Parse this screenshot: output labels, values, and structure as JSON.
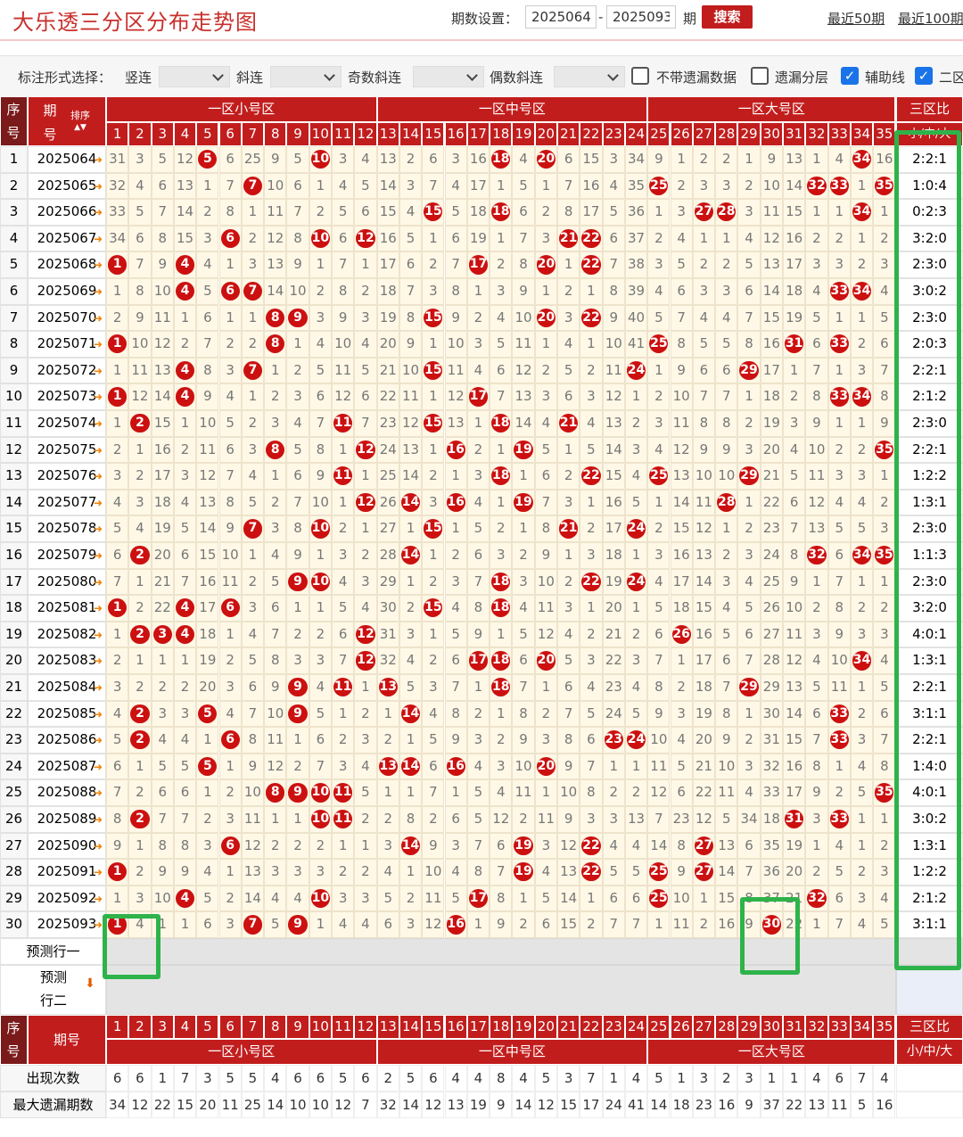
{
  "title": "大乐透三分区分布走势图",
  "period_setting": {
    "label": "期数设置：",
    "from": "2025064",
    "dash": "-",
    "to": "2025093",
    "unit": "期",
    "search": "搜索"
  },
  "links": [
    "最近50期",
    "最近100期"
  ],
  "filters": {
    "label": "标注形式选择：",
    "items": [
      "竖连",
      "斜连",
      "奇数斜连",
      "偶数斜连"
    ],
    "checks": [
      {
        "label": "不带遗漏数据",
        "checked": false
      },
      {
        "label": "遗漏分层",
        "checked": false
      },
      {
        "label": "辅助线",
        "checked": true
      },
      {
        "label": "二区",
        "checked": true
      }
    ]
  },
  "header": {
    "seq": "序号",
    "period": "期号",
    "sort": "排序",
    "zones": [
      "一区小号区",
      "一区中号区",
      "一区大号区"
    ],
    "ratio": "三区比",
    "ratio_sub": "小/中/大"
  },
  "numbers": [
    "1",
    "2",
    "3",
    "4",
    "5",
    "6",
    "7",
    "8",
    "9",
    "10",
    "11",
    "12",
    "13",
    "14",
    "15",
    "16",
    "17",
    "18",
    "19",
    "20",
    "21",
    "22",
    "23",
    "24",
    "25",
    "26",
    "27",
    "28",
    "29",
    "30",
    "31",
    "32",
    "33",
    "34",
    "35"
  ],
  "rows": [
    {
      "seq": "1",
      "period": "2025064",
      "ratio": "2:2:1",
      "cells": [
        31,
        3,
        5,
        12,
        "*",
        6,
        25,
        9,
        5,
        "*",
        3,
        4,
        13,
        2,
        6,
        3,
        16,
        "*",
        4,
        "*",
        6,
        15,
        3,
        34,
        9,
        1,
        2,
        2,
        1,
        9,
        13,
        1,
        4,
        "*",
        16
      ]
    },
    {
      "seq": "2",
      "period": "2025065",
      "ratio": "1:0:4",
      "cells": [
        32,
        4,
        6,
        13,
        1,
        7,
        "*",
        10,
        6,
        1,
        4,
        5,
        14,
        3,
        7,
        4,
        17,
        1,
        5,
        1,
        7,
        16,
        4,
        35,
        "*",
        2,
        3,
        3,
        2,
        10,
        14,
        "*",
        "*",
        1,
        "*"
      ]
    },
    {
      "seq": "3",
      "period": "2025066",
      "ratio": "0:2:3",
      "cells": [
        33,
        5,
        7,
        14,
        2,
        8,
        1,
        11,
        7,
        2,
        5,
        6,
        15,
        4,
        "*",
        5,
        18,
        "*",
        6,
        2,
        8,
        17,
        5,
        36,
        1,
        3,
        "*",
        "*",
        3,
        11,
        15,
        1,
        1,
        "*",
        1
      ]
    },
    {
      "seq": "4",
      "period": "2025067",
      "ratio": "3:2:0",
      "cells": [
        34,
        6,
        8,
        15,
        3,
        "*",
        2,
        12,
        8,
        "*",
        6,
        "*",
        16,
        5,
        1,
        6,
        19,
        1,
        7,
        3,
        "*",
        "*",
        6,
        37,
        2,
        4,
        1,
        1,
        4,
        12,
        16,
        2,
        2,
        1,
        2
      ]
    },
    {
      "seq": "5",
      "period": "2025068",
      "ratio": "2:3:0",
      "cells": [
        "*",
        7,
        9,
        "*",
        4,
        1,
        3,
        13,
        9,
        1,
        7,
        1,
        17,
        6,
        2,
        7,
        "*",
        2,
        8,
        "*",
        1,
        "*",
        7,
        38,
        3,
        5,
        2,
        2,
        5,
        13,
        17,
        3,
        3,
        2,
        3
      ]
    },
    {
      "seq": "6",
      "period": "2025069",
      "ratio": "3:0:2",
      "cells": [
        1,
        8,
        10,
        "*",
        5,
        "*",
        "*",
        14,
        10,
        2,
        8,
        2,
        18,
        7,
        3,
        8,
        1,
        3,
        9,
        1,
        2,
        1,
        8,
        39,
        4,
        6,
        3,
        3,
        6,
        14,
        18,
        4,
        "*",
        "*",
        4
      ]
    },
    {
      "seq": "7",
      "period": "2025070",
      "ratio": "2:3:0",
      "cells": [
        2,
        9,
        11,
        1,
        6,
        1,
        1,
        "*",
        "*",
        3,
        9,
        3,
        19,
        8,
        "*",
        9,
        2,
        4,
        10,
        "*",
        3,
        "*",
        9,
        40,
        5,
        7,
        4,
        4,
        7,
        15,
        19,
        5,
        1,
        1,
        5
      ]
    },
    {
      "seq": "8",
      "period": "2025071",
      "ratio": "2:0:3",
      "cells": [
        "*",
        10,
        12,
        2,
        7,
        2,
        2,
        "*",
        1,
        4,
        10,
        4,
        20,
        9,
        1,
        10,
        3,
        5,
        11,
        1,
        4,
        1,
        10,
        41,
        "*",
        8,
        5,
        5,
        8,
        16,
        "*",
        6,
        "*",
        2,
        6
      ]
    },
    {
      "seq": "9",
      "period": "2025072",
      "ratio": "2:2:1",
      "cells": [
        1,
        11,
        13,
        "*",
        8,
        3,
        "*",
        1,
        2,
        5,
        11,
        5,
        21,
        10,
        "*",
        11,
        4,
        6,
        12,
        2,
        5,
        2,
        11,
        "*",
        1,
        9,
        6,
        6,
        "*",
        17,
        1,
        7,
        1,
        3,
        7
      ]
    },
    {
      "seq": "10",
      "period": "2025073",
      "ratio": "2:1:2",
      "cells": [
        "*",
        12,
        14,
        "*",
        9,
        4,
        1,
        2,
        3,
        6,
        12,
        6,
        22,
        11,
        1,
        12,
        "*",
        7,
        13,
        3,
        6,
        3,
        12,
        1,
        2,
        10,
        7,
        7,
        1,
        18,
        2,
        8,
        "*",
        "*",
        8
      ]
    },
    {
      "seq": "11",
      "period": "2025074",
      "ratio": "2:3:0",
      "cells": [
        1,
        "*",
        15,
        1,
        10,
        5,
        2,
        3,
        4,
        7,
        "*",
        7,
        23,
        12,
        "*",
        13,
        1,
        "*",
        14,
        4,
        "*",
        4,
        13,
        2,
        3,
        11,
        8,
        8,
        2,
        19,
        3,
        9,
        1,
        1,
        9
      ]
    },
    {
      "seq": "12",
      "period": "2025075",
      "ratio": "2:2:1",
      "cells": [
        2,
        1,
        16,
        2,
        11,
        6,
        3,
        "*",
        5,
        8,
        1,
        "*",
        24,
        13,
        1,
        "*",
        2,
        1,
        "*",
        5,
        1,
        5,
        14,
        3,
        4,
        12,
        9,
        9,
        3,
        20,
        4,
        10,
        2,
        2,
        "*"
      ]
    },
    {
      "seq": "13",
      "period": "2025076",
      "ratio": "1:2:2",
      "cells": [
        3,
        2,
        17,
        3,
        12,
        7,
        4,
        1,
        6,
        9,
        "*",
        1,
        25,
        14,
        2,
        1,
        3,
        "*",
        1,
        6,
        2,
        "*",
        15,
        4,
        "*",
        13,
        10,
        10,
        "*",
        21,
        5,
        11,
        3,
        3,
        1
      ]
    },
    {
      "seq": "14",
      "period": "2025077",
      "ratio": "1:3:1",
      "cells": [
        4,
        3,
        18,
        4,
        13,
        8,
        5,
        2,
        7,
        10,
        1,
        "*",
        26,
        "*",
        3,
        "*",
        4,
        1,
        "*",
        7,
        3,
        1,
        16,
        5,
        1,
        14,
        11,
        "*",
        1,
        22,
        6,
        12,
        4,
        4,
        2
      ]
    },
    {
      "seq": "15",
      "period": "2025078",
      "ratio": "2:3:0",
      "cells": [
        5,
        4,
        19,
        5,
        14,
        9,
        "*",
        3,
        8,
        "*",
        2,
        1,
        27,
        1,
        "*",
        1,
        5,
        2,
        1,
        8,
        "*",
        2,
        17,
        "*",
        2,
        15,
        12,
        1,
        2,
        23,
        7,
        13,
        5,
        5,
        3
      ]
    },
    {
      "seq": "16",
      "period": "2025079",
      "ratio": "1:1:3",
      "cells": [
        6,
        "*",
        20,
        6,
        15,
        10,
        1,
        4,
        9,
        1,
        3,
        2,
        28,
        "*",
        1,
        2,
        6,
        3,
        2,
        9,
        1,
        3,
        18,
        1,
        3,
        16,
        13,
        2,
        3,
        24,
        8,
        "*",
        6,
        "*",
        "*"
      ]
    },
    {
      "seq": "17",
      "period": "2025080",
      "ratio": "2:3:0",
      "cells": [
        7,
        1,
        21,
        7,
        16,
        11,
        2,
        5,
        "*",
        "*",
        4,
        3,
        29,
        1,
        2,
        3,
        7,
        "*",
        3,
        10,
        2,
        "*",
        19,
        "*",
        4,
        17,
        14,
        3,
        4,
        25,
        9,
        1,
        7,
        1,
        1
      ]
    },
    {
      "seq": "18",
      "period": "2025081",
      "ratio": "3:2:0",
      "cells": [
        "*",
        2,
        22,
        "*",
        17,
        "*",
        3,
        6,
        1,
        1,
        5,
        4,
        30,
        2,
        "*",
        4,
        8,
        "*",
        4,
        11,
        3,
        1,
        20,
        1,
        5,
        18,
        15,
        4,
        5,
        26,
        10,
        2,
        8,
        2,
        2
      ]
    },
    {
      "seq": "19",
      "period": "2025082",
      "ratio": "4:0:1",
      "cells": [
        1,
        "*",
        "*",
        "*",
        18,
        1,
        4,
        7,
        2,
        2,
        6,
        "*",
        31,
        3,
        1,
        5,
        9,
        1,
        5,
        12,
        4,
        2,
        21,
        2,
        6,
        "*",
        16,
        5,
        6,
        27,
        11,
        3,
        9,
        3,
        3
      ]
    },
    {
      "seq": "20",
      "period": "2025083",
      "ratio": "1:3:1",
      "cells": [
        2,
        1,
        1,
        1,
        19,
        2,
        5,
        8,
        3,
        3,
        7,
        "*",
        32,
        4,
        2,
        6,
        "*",
        "*",
        6,
        "*",
        5,
        3,
        22,
        3,
        7,
        1,
        17,
        6,
        7,
        28,
        12,
        4,
        10,
        "*",
        4
      ]
    },
    {
      "seq": "21",
      "period": "2025084",
      "ratio": "2:2:1",
      "cells": [
        3,
        2,
        2,
        2,
        20,
        3,
        6,
        9,
        "*",
        4,
        "*",
        1,
        "*",
        5,
        3,
        7,
        1,
        "*",
        7,
        1,
        6,
        4,
        23,
        4,
        8,
        2,
        18,
        7,
        "*",
        29,
        13,
        5,
        11,
        1,
        5
      ]
    },
    {
      "seq": "22",
      "period": "2025085",
      "ratio": "3:1:1",
      "cells": [
        4,
        "*",
        3,
        3,
        "*",
        4,
        7,
        10,
        "*",
        5,
        1,
        2,
        1,
        "*",
        4,
        8,
        2,
        1,
        8,
        2,
        7,
        5,
        24,
        5,
        9,
        3,
        19,
        8,
        1,
        30,
        14,
        6,
        "*",
        2,
        6
      ]
    },
    {
      "seq": "23",
      "period": "2025086",
      "ratio": "2:2:1",
      "cells": [
        5,
        "*",
        4,
        4,
        1,
        "*",
        8,
        11,
        1,
        6,
        2,
        3,
        2,
        1,
        5,
        9,
        3,
        2,
        9,
        3,
        8,
        6,
        "*",
        "*",
        10,
        4,
        20,
        9,
        2,
        31,
        15,
        7,
        "*",
        3,
        7
      ]
    },
    {
      "seq": "24",
      "period": "2025087",
      "ratio": "1:4:0",
      "cells": [
        6,
        1,
        5,
        5,
        "*",
        1,
        9,
        12,
        2,
        7,
        3,
        4,
        "*",
        "*",
        6,
        "*",
        4,
        3,
        10,
        "*",
        9,
        7,
        1,
        1,
        11,
        5,
        21,
        10,
        3,
        32,
        16,
        8,
        1,
        4,
        8
      ]
    },
    {
      "seq": "25",
      "period": "2025088",
      "ratio": "4:0:1",
      "cells": [
        7,
        2,
        6,
        6,
        1,
        2,
        10,
        "*",
        "*",
        "*",
        "*",
        5,
        1,
        1,
        7,
        1,
        5,
        4,
        11,
        1,
        10,
        8,
        2,
        2,
        12,
        6,
        22,
        11,
        4,
        33,
        17,
        9,
        2,
        5,
        "*"
      ]
    },
    {
      "seq": "26",
      "period": "2025089",
      "ratio": "3:0:2",
      "cells": [
        8,
        "*",
        7,
        7,
        2,
        3,
        11,
        1,
        1,
        "*",
        "*",
        2,
        2,
        8,
        2,
        6,
        5,
        12,
        2,
        11,
        9,
        3,
        3,
        13,
        7,
        23,
        12,
        5,
        34,
        18,
        "*",
        3,
        "*",
        1,
        1
      ]
    },
    {
      "seq": "27",
      "period": "2025090",
      "ratio": "1:3:1",
      "cells": [
        9,
        1,
        8,
        8,
        3,
        "*",
        12,
        2,
        2,
        2,
        1,
        1,
        3,
        "*",
        9,
        3,
        7,
        6,
        "*",
        3,
        12,
        "*",
        4,
        4,
        14,
        8,
        "*",
        13,
        6,
        35,
        19,
        1,
        4,
        1,
        2
      ]
    },
    {
      "seq": "28",
      "period": "2025091",
      "ratio": "1:2:2",
      "cells": [
        "*",
        2,
        9,
        9,
        4,
        1,
        13,
        3,
        3,
        3,
        2,
        2,
        4,
        1,
        10,
        4,
        8,
        7,
        "*",
        4,
        13,
        "*",
        5,
        5,
        "*",
        9,
        "*",
        14,
        7,
        36,
        20,
        2,
        5,
        2,
        3
      ]
    },
    {
      "seq": "29",
      "period": "2025092",
      "ratio": "2:1:2",
      "cells": [
        1,
        3,
        10,
        "*",
        5,
        2,
        14,
        4,
        4,
        "*",
        3,
        3,
        5,
        2,
        11,
        5,
        "*",
        8,
        1,
        5,
        14,
        1,
        6,
        6,
        "*",
        10,
        1,
        15,
        8,
        37,
        21,
        "*",
        6,
        3,
        4
      ]
    },
    {
      "seq": "30",
      "period": "2025093",
      "ratio": "3:1:1",
      "cells": [
        "*",
        4,
        1,
        1,
        6,
        3,
        "*",
        5,
        "*",
        1,
        4,
        4,
        6,
        3,
        12,
        "*",
        1,
        9,
        2,
        6,
        15,
        2,
        7,
        7,
        1,
        11,
        2,
        16,
        9,
        "*",
        22,
        1,
        7,
        4,
        5
      ]
    }
  ],
  "predict": {
    "row1": "预测行一",
    "row2a": "预测",
    "row2b": "行二"
  },
  "footer": {
    "seq": "序号",
    "period": "期号",
    "ratio": "三区比",
    "ratio_sub": "小/中/大"
  },
  "stats": [
    {
      "label": "出现次数",
      "values": [
        6,
        6,
        1,
        7,
        3,
        5,
        5,
        4,
        6,
        6,
        5,
        6,
        2,
        5,
        6,
        4,
        4,
        8,
        4,
        5,
        3,
        7,
        1,
        4,
        5,
        1,
        3,
        2,
        3,
        1,
        1,
        4,
        6,
        7,
        4
      ]
    },
    {
      "label": "最大遗漏期数",
      "values": [
        34,
        12,
        22,
        15,
        20,
        11,
        25,
        14,
        10,
        10,
        12,
        7,
        32,
        14,
        12,
        13,
        19,
        9,
        14,
        12,
        15,
        17,
        24,
        41,
        14,
        18,
        23,
        16,
        9,
        37,
        22,
        13,
        11,
        5,
        16
      ]
    }
  ],
  "colors": {
    "red": "#c21d1d",
    "ball": "#cc1010",
    "cell_bg": "#fff8e6",
    "highlight": "#2eb34a",
    "gray": "#e4e4e4"
  }
}
